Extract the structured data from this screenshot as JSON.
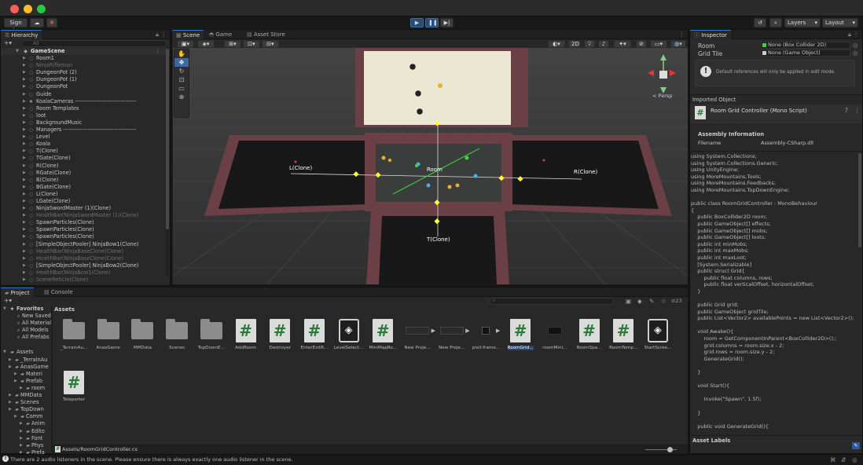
{
  "topbar": {
    "sign_in": "Sign in",
    "layers": "Layers",
    "layout": "Layout"
  },
  "hierarchy": {
    "tab": "Hierarchy",
    "search_placeholder": "All",
    "scene": "GameScene",
    "items": [
      {
        "label": "Room1",
        "dim": false,
        "icon": "gameobject"
      },
      {
        "label": "NinjaRifleman",
        "dim": true,
        "icon": "gameobject"
      },
      {
        "label": "DungeonPot (2)",
        "dim": false,
        "icon": "gameobject"
      },
      {
        "label": "DungeonPot (1)",
        "dim": false,
        "icon": "gameobject"
      },
      {
        "label": "DungeonPot",
        "dim": false,
        "icon": "gameobject"
      },
      {
        "label": "Guide",
        "dim": false,
        "icon": "gameobject"
      },
      {
        "label": "KoalaCameras ---------------------------------",
        "dim": false,
        "icon": "star"
      },
      {
        "label": "Room Templates",
        "dim": false,
        "icon": "gameobject"
      },
      {
        "label": "loot",
        "dim": false,
        "icon": "gameobject"
      },
      {
        "label": "BackgroundMusic",
        "dim": false,
        "icon": "gameobject"
      },
      {
        "label": "Managers ---------------------------------------",
        "dim": false,
        "icon": "gameobject"
      },
      {
        "label": "Level",
        "dim": false,
        "icon": "gameobject"
      },
      {
        "label": "Koala",
        "dim": false,
        "icon": "gameobject"
      },
      {
        "label": "T(Clone)",
        "dim": false,
        "icon": "gameobject"
      },
      {
        "label": "TGate(Clone)",
        "dim": false,
        "icon": "gameobject"
      },
      {
        "label": "R(Clone)",
        "dim": false,
        "icon": "gameobject"
      },
      {
        "label": "RGate(Clone)",
        "dim": false,
        "icon": "gameobject"
      },
      {
        "label": "B(Clone)",
        "dim": false,
        "icon": "gameobject"
      },
      {
        "label": "BGate(Clone)",
        "dim": false,
        "icon": "gameobject"
      },
      {
        "label": "L(Clone)",
        "dim": false,
        "icon": "gameobject"
      },
      {
        "label": "LGate(Clone)",
        "dim": false,
        "icon": "gameobject"
      },
      {
        "label": "NinjaSwordMaster (1)(Clone)",
        "dim": false,
        "icon": "gameobject"
      },
      {
        "label": "HealthBar(NinjaSwordMaster (1)(Clone)",
        "dim": true,
        "icon": "gameobject"
      },
      {
        "label": "SpawnParticles(Clone)",
        "dim": false,
        "icon": "gameobject"
      },
      {
        "label": "SpawnParticles(Clone)",
        "dim": false,
        "icon": "gameobject"
      },
      {
        "label": "SpawnParticles(Clone)",
        "dim": false,
        "icon": "gameobject"
      },
      {
        "label": "[SimpleObjectPooler] NinjaBow1(Clone)",
        "dim": false,
        "icon": "gameobject"
      },
      {
        "label": "HealthBar(NinjaBaseClone(Clone)",
        "dim": true,
        "icon": "gameobject"
      },
      {
        "label": "HealthBar(NinjaBaseClone(Clone)",
        "dim": true,
        "icon": "gameobject"
      },
      {
        "label": "[SimpleObjectPooler] NinjaBow2(Clone)",
        "dim": false,
        "icon": "gameobject"
      },
      {
        "label": "HealthBar(NinjaBow1(Clone)",
        "dim": true,
        "icon": "gameobject"
      },
      {
        "label": "SceneReticle(Clone)",
        "dim": true,
        "icon": "gameobject"
      }
    ]
  },
  "scene": {
    "tabs": [
      "Scene",
      "Game",
      "Asset Store"
    ],
    "mode_2d": "2D",
    "persp": "< Persp",
    "labels": {
      "room": "Room",
      "left": "L(Clone)",
      "right": "R(Clone)",
      "bottom": "T(Clone)"
    }
  },
  "inspector": {
    "tab": "Inspector",
    "fields": [
      {
        "label": "Room",
        "value": "None (Box Collider 2D)"
      },
      {
        "label": "Grid Tile",
        "value": "None (Game Object)"
      }
    ],
    "info": "Default references will only be applied in edit mode.",
    "imported_object": "Imported Object",
    "script_title": "Room Grid Controller (Mono Script)",
    "assembly_info": "Assembly Information",
    "filename_label": "Filename",
    "filename_value": "Assembly-CSharp.dll",
    "code": "using System.Collections;\nusing System.Collections.Generic;\nusing UnityEngine;\nusing MoreMountains.Tools;\nusing MoreMountains.Feedbacks;\nusing MoreMountains.TopDownEngine;\n\npublic class RoomGridController : MonoBehaviour\n{\n    public BoxCollider2D room;\n    public GameObject[] effects;\n    public GameObject[] mobs;\n    public GameObject[] loots;\n    public int minMobs;\n    public int maxMobs;\n    public int maxLoot;\n    [System.Serializable]\n    public struct Grid{\n        public float columns, rows;\n        public float verticalOffset, horizontalOffset;\n    }\n\n    public Grid grid;\n    public GameObject gridTile;\n    public List<Vector2> availablePoints = new List<Vector2>();\n\n    void Awake(){\n        room = GetComponentInParent<BoxCollider2D>();;\n        grid.columns = room.size.x - 2;\n        grid.rows = room.size.y - 2;\n        GenerateGrid();\n\n    }\n\n    void Start(){\n\n        Invoke(\"Spawn\", 1.5f);\n\n    }\n\n    public void GenerateGrid(){\n\n        grid.verticalOffset += room.transform.localPosition.y;",
    "asset_labels": "Asset Labels"
  },
  "project": {
    "tabs": [
      "Project",
      "Console"
    ],
    "favorites_title": "Favorites",
    "favorites": [
      "New Saved",
      "All Materials",
      "All Models",
      "All Prefabs"
    ],
    "assets_title": "Assets",
    "tree": [
      {
        "label": "_TerrainAu",
        "indent": 1
      },
      {
        "label": "AnasGame",
        "indent": 1
      },
      {
        "label": "Materi",
        "indent": 2
      },
      {
        "label": "Prefab",
        "indent": 2
      },
      {
        "label": "room",
        "indent": 3
      },
      {
        "label": "MMData",
        "indent": 1
      },
      {
        "label": "Scenes",
        "indent": 1
      },
      {
        "label": "TopDown",
        "indent": 1
      },
      {
        "label": "Comm",
        "indent": 2
      },
      {
        "label": "Anim",
        "indent": 3
      },
      {
        "label": "Edito",
        "indent": 3
      },
      {
        "label": "Font",
        "indent": 3
      },
      {
        "label": "Phys",
        "indent": 3
      },
      {
        "label": "Prefa",
        "indent": 3
      }
    ],
    "breadcrumb": "Assets",
    "asset_count": "23",
    "assets": [
      {
        "label": "_TerrainAu...",
        "kind": "folder"
      },
      {
        "label": "AnasGame",
        "kind": "folder"
      },
      {
        "label": "MMData",
        "kind": "folder"
      },
      {
        "label": "Scenes",
        "kind": "folder"
      },
      {
        "label": "TopDownE...",
        "kind": "folder"
      },
      {
        "label": "AddRoom",
        "kind": "script"
      },
      {
        "label": "Destroyer",
        "kind": "script"
      },
      {
        "label": "EnterExitR...",
        "kind": "script"
      },
      {
        "label": "LevelSelect...",
        "kind": "unity"
      },
      {
        "label": "MiniMapRo...",
        "kind": "script"
      },
      {
        "label": "New Proje...",
        "kind": "prefab"
      },
      {
        "label": "New Proje...",
        "kind": "prefab"
      },
      {
        "label": "pixil-frame...",
        "kind": "prefab-small"
      },
      {
        "label": "RoomGrid...",
        "kind": "script",
        "selected": true
      },
      {
        "label": "roomMini...",
        "kind": "prefab-dark"
      },
      {
        "label": "RoomSpa...",
        "kind": "script"
      },
      {
        "label": "RoomTemp...",
        "kind": "script"
      },
      {
        "label": "StartScree...",
        "kind": "unity"
      },
      {
        "label": "Teleporter",
        "kind": "script"
      }
    ],
    "path": "Assets/RoomGridController.cs"
  },
  "status": {
    "message": "There are 2 audio listeners in the scene. Please ensure there is always exactly one audio listener in the scene."
  }
}
